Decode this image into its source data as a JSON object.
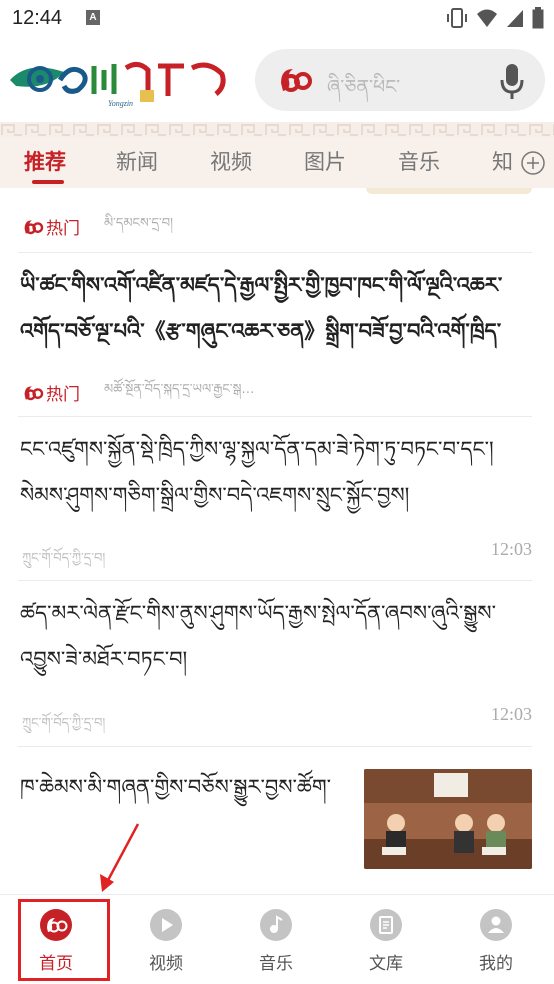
{
  "status_bar": {
    "time": "12:44",
    "notification_icon": "A"
  },
  "header": {
    "logo_text": "Yongzin",
    "search_placeholder": "ཞི་ཅིན་ཕིང་"
  },
  "tabs": [
    {
      "label": "推荐",
      "active": true
    },
    {
      "label": "新闻"
    },
    {
      "label": "视频"
    },
    {
      "label": "图片"
    },
    {
      "label": "音乐"
    },
    {
      "label": "知"
    }
  ],
  "feed": {
    "items": [
      {
        "tag": "热门",
        "source": "མི་དམངས་དྲ་བ།"
      },
      {
        "title": "ཡི་ཚང་གིས་འགོ་འཛིན་མཛད་དེ་རྒྱལ་སྤྱིར་གྱི་ཁྱབ་ཁང་གི་ལོ་ལྔའི་འཆར་འགོད་བཅོ་ལྔ་པའི་《རྩ་གཞུང་འཆར་ཅན》སྒྲིག་བཟོ་བྱ་བའི་འགོ་ཁྲིད་ཚོགས་ཆུང་གི་…"
      },
      {
        "tag": "热门",
        "source": "མཚོ་སྔོན་བོད་སྐད་དྲ་ཡལ་རྒྱང་སྒ…"
      },
      {
        "title": "ངང་འཛུགས་སྐྱོན་སྡེ་ཁྲིད་ཀྱིས་ལྷ་སྐྱལ་དོན་དམ་ཟེ་ཏེག་ཏུ་བཏང་བ་དང་། སེམས་ཤུགས་གཅིག་སྒྲིལ་གྱིས་བདེ་འཇགས་སྲུང་སྐྱོང་བྱས།",
        "source": "ཀྲུང་གོ་བོད་ཀྱི་དྲ་བ།",
        "time": "12:03"
      },
      {
        "title": "ཚད་མར་ལེན་རྫོང་གིས་ནུས་ཤུགས་ཡོད་རྒྱས་སྤེལ་དོན་ཞབས་ཞུའི་སྒྱུས་འབྱུས་ཟེ་མཐོར་བཏང་བ།",
        "source": "ཀྲུང་གོ་བོད་ཀྱི་དྲ་བ།",
        "time": "12:03"
      },
      {
        "title": "ཁ་ཆེམས་མི་གཞན་གྱིས་བཅོས་སྒྱུར་བྱས་ཚོག་གམ།"
      }
    ]
  },
  "bottom_nav": [
    {
      "label": "首页",
      "icon": "home-logo-icon",
      "active": true
    },
    {
      "label": "视频",
      "icon": "play-icon"
    },
    {
      "label": "音乐",
      "icon": "music-note-icon"
    },
    {
      "label": "文库",
      "icon": "document-icon"
    },
    {
      "label": "我的",
      "icon": "user-icon"
    }
  ],
  "colors": {
    "accent": "#c72128",
    "annotation": "#e02222"
  }
}
